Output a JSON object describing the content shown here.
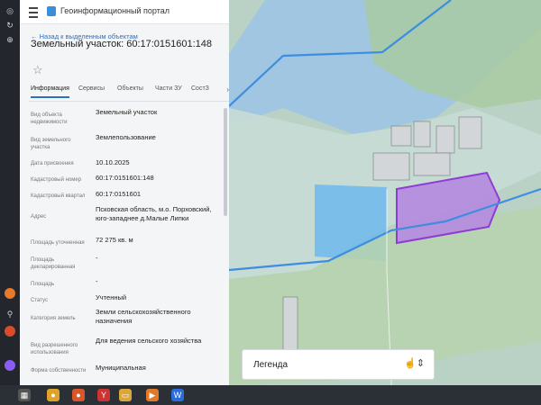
{
  "app": {
    "title": "Геоинформационный портал"
  },
  "back_link": "← Назад к выделенным объектам",
  "page_title": "Земельный участок: 60:17:0151601:148",
  "tabs": [
    "Информация",
    "Сервисы",
    "Объекты",
    "Части ЗУ",
    "СостЗ"
  ],
  "fields": [
    {
      "label": "Вид объекта недвижимости",
      "value": "Земельный участок"
    },
    {
      "label": "Вид земельного участка",
      "value": "Землепользование"
    },
    {
      "label": "Дата присвоения",
      "value": "10.10.2025"
    },
    {
      "label": "Кадастровый номер",
      "value": "60:17:0151601:148"
    },
    {
      "label": "Кадастровый квартал",
      "value": "60:17:0151601"
    },
    {
      "label": "Адрес",
      "value": "Псковская область, м.о. Порховский, юго-западнее д.Малые Липки"
    },
    {
      "label": "Площадь уточненная",
      "value": "72 275 кв. м"
    },
    {
      "label": "Площадь декларированная",
      "value": "-"
    },
    {
      "label": "Площадь",
      "value": "-"
    },
    {
      "label": "Статус",
      "value": "Учтенный"
    },
    {
      "label": "Категория земель",
      "value": "Земли сельскохозяйственного назначения"
    },
    {
      "label": "Вид разрешенного использования",
      "value": "Для ведения сельского хозяйства"
    },
    {
      "label": "Форма собственности",
      "value": "Муниципальная"
    }
  ],
  "legend": {
    "label": "Легенда"
  },
  "colors": {
    "accent": "#2f6fc2",
    "parcel_fill": "#b58be0",
    "parcel_stroke": "#8a2bd6",
    "zone_blue": "#8fc0ea"
  },
  "icons": [
    "menu-icon",
    "portal-logo-icon",
    "star-icon",
    "chevron-right-icon",
    "hand-cursor-icon",
    "chevron-updown-icon"
  ]
}
